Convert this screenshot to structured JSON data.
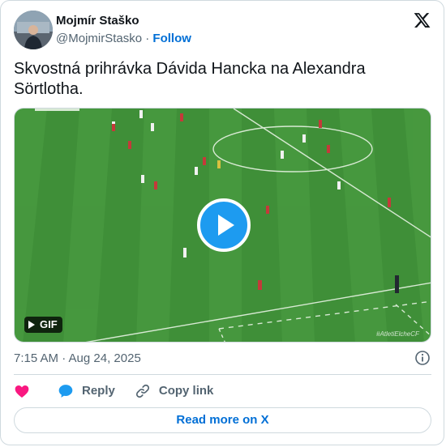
{
  "author": {
    "name": "Mojmír Staško",
    "handle": "@MojmirStasko",
    "separator": "·",
    "follow_label": "Follow"
  },
  "tweet": {
    "text": "Skvostná prihrávka Dávida Hancka na Alexandra Sörtlotha."
  },
  "media": {
    "type_badge": "GIF",
    "watermark": "#AtletiElcheCF",
    "play_icon": "play-icon"
  },
  "meta": {
    "timestamp": "7:15 AM · Aug 24, 2025",
    "info_icon": "info-icon"
  },
  "actions": {
    "like_icon": "heart-icon",
    "reply_label": "Reply",
    "copy_label": "Copy link"
  },
  "footer": {
    "read_more_label": "Read more on X"
  },
  "colors": {
    "accent_blue": "#1d9bf0",
    "link_blue": "#006fd6",
    "like_pink": "#f91880",
    "secondary_text": "#536471",
    "border": "#cfd9de",
    "pitch_green": "#3f8f38"
  }
}
